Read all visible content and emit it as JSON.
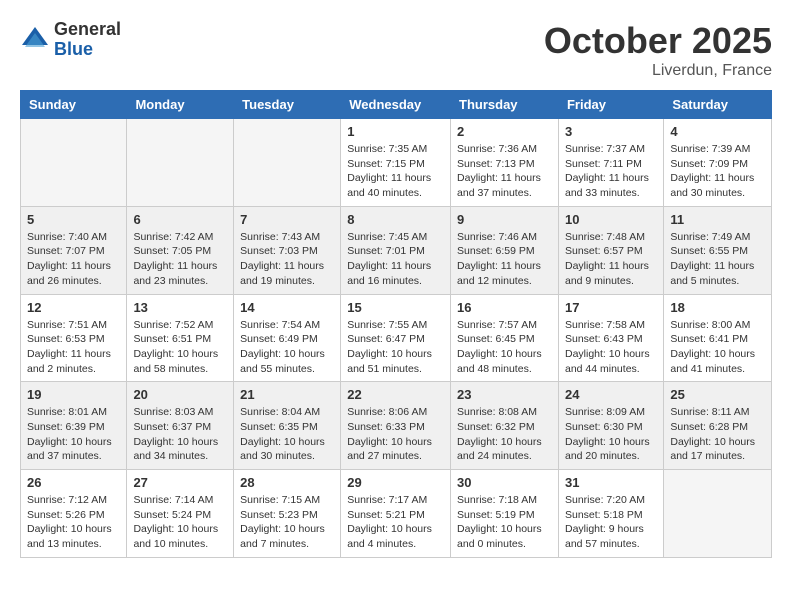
{
  "logo": {
    "general": "General",
    "blue": "Blue"
  },
  "header": {
    "month": "October 2025",
    "location": "Liverdun, France"
  },
  "weekdays": [
    "Sunday",
    "Monday",
    "Tuesday",
    "Wednesday",
    "Thursday",
    "Friday",
    "Saturday"
  ],
  "weeks": [
    [
      {
        "day": "",
        "info": ""
      },
      {
        "day": "",
        "info": ""
      },
      {
        "day": "",
        "info": ""
      },
      {
        "day": "1",
        "info": "Sunrise: 7:35 AM\nSunset: 7:15 PM\nDaylight: 11 hours\nand 40 minutes."
      },
      {
        "day": "2",
        "info": "Sunrise: 7:36 AM\nSunset: 7:13 PM\nDaylight: 11 hours\nand 37 minutes."
      },
      {
        "day": "3",
        "info": "Sunrise: 7:37 AM\nSunset: 7:11 PM\nDaylight: 11 hours\nand 33 minutes."
      },
      {
        "day": "4",
        "info": "Sunrise: 7:39 AM\nSunset: 7:09 PM\nDaylight: 11 hours\nand 30 minutes."
      }
    ],
    [
      {
        "day": "5",
        "info": "Sunrise: 7:40 AM\nSunset: 7:07 PM\nDaylight: 11 hours\nand 26 minutes."
      },
      {
        "day": "6",
        "info": "Sunrise: 7:42 AM\nSunset: 7:05 PM\nDaylight: 11 hours\nand 23 minutes."
      },
      {
        "day": "7",
        "info": "Sunrise: 7:43 AM\nSunset: 7:03 PM\nDaylight: 11 hours\nand 19 minutes."
      },
      {
        "day": "8",
        "info": "Sunrise: 7:45 AM\nSunset: 7:01 PM\nDaylight: 11 hours\nand 16 minutes."
      },
      {
        "day": "9",
        "info": "Sunrise: 7:46 AM\nSunset: 6:59 PM\nDaylight: 11 hours\nand 12 minutes."
      },
      {
        "day": "10",
        "info": "Sunrise: 7:48 AM\nSunset: 6:57 PM\nDaylight: 11 hours\nand 9 minutes."
      },
      {
        "day": "11",
        "info": "Sunrise: 7:49 AM\nSunset: 6:55 PM\nDaylight: 11 hours\nand 5 minutes."
      }
    ],
    [
      {
        "day": "12",
        "info": "Sunrise: 7:51 AM\nSunset: 6:53 PM\nDaylight: 11 hours\nand 2 minutes."
      },
      {
        "day": "13",
        "info": "Sunrise: 7:52 AM\nSunset: 6:51 PM\nDaylight: 10 hours\nand 58 minutes."
      },
      {
        "day": "14",
        "info": "Sunrise: 7:54 AM\nSunset: 6:49 PM\nDaylight: 10 hours\nand 55 minutes."
      },
      {
        "day": "15",
        "info": "Sunrise: 7:55 AM\nSunset: 6:47 PM\nDaylight: 10 hours\nand 51 minutes."
      },
      {
        "day": "16",
        "info": "Sunrise: 7:57 AM\nSunset: 6:45 PM\nDaylight: 10 hours\nand 48 minutes."
      },
      {
        "day": "17",
        "info": "Sunrise: 7:58 AM\nSunset: 6:43 PM\nDaylight: 10 hours\nand 44 minutes."
      },
      {
        "day": "18",
        "info": "Sunrise: 8:00 AM\nSunset: 6:41 PM\nDaylight: 10 hours\nand 41 minutes."
      }
    ],
    [
      {
        "day": "19",
        "info": "Sunrise: 8:01 AM\nSunset: 6:39 PM\nDaylight: 10 hours\nand 37 minutes."
      },
      {
        "day": "20",
        "info": "Sunrise: 8:03 AM\nSunset: 6:37 PM\nDaylight: 10 hours\nand 34 minutes."
      },
      {
        "day": "21",
        "info": "Sunrise: 8:04 AM\nSunset: 6:35 PM\nDaylight: 10 hours\nand 30 minutes."
      },
      {
        "day": "22",
        "info": "Sunrise: 8:06 AM\nSunset: 6:33 PM\nDaylight: 10 hours\nand 27 minutes."
      },
      {
        "day": "23",
        "info": "Sunrise: 8:08 AM\nSunset: 6:32 PM\nDaylight: 10 hours\nand 24 minutes."
      },
      {
        "day": "24",
        "info": "Sunrise: 8:09 AM\nSunset: 6:30 PM\nDaylight: 10 hours\nand 20 minutes."
      },
      {
        "day": "25",
        "info": "Sunrise: 8:11 AM\nSunset: 6:28 PM\nDaylight: 10 hours\nand 17 minutes."
      }
    ],
    [
      {
        "day": "26",
        "info": "Sunrise: 7:12 AM\nSunset: 5:26 PM\nDaylight: 10 hours\nand 13 minutes."
      },
      {
        "day": "27",
        "info": "Sunrise: 7:14 AM\nSunset: 5:24 PM\nDaylight: 10 hours\nand 10 minutes."
      },
      {
        "day": "28",
        "info": "Sunrise: 7:15 AM\nSunset: 5:23 PM\nDaylight: 10 hours\nand 7 minutes."
      },
      {
        "day": "29",
        "info": "Sunrise: 7:17 AM\nSunset: 5:21 PM\nDaylight: 10 hours\nand 4 minutes."
      },
      {
        "day": "30",
        "info": "Sunrise: 7:18 AM\nSunset: 5:19 PM\nDaylight: 10 hours\nand 0 minutes."
      },
      {
        "day": "31",
        "info": "Sunrise: 7:20 AM\nSunset: 5:18 PM\nDaylight: 9 hours\nand 57 minutes."
      },
      {
        "day": "",
        "info": ""
      }
    ]
  ]
}
